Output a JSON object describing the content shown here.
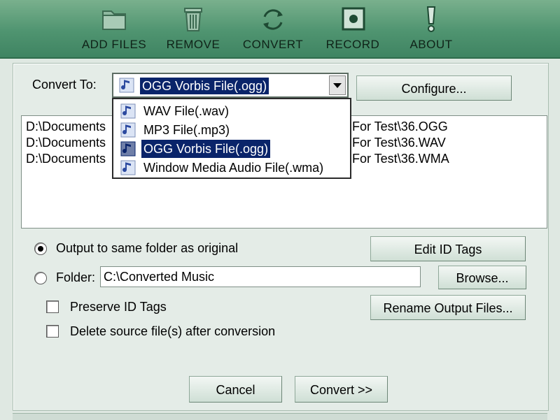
{
  "toolbar": {
    "add_files": "ADD FILES",
    "remove": "REMOVE",
    "convert": "CONVERT",
    "record": "RECORD",
    "about": "ABOUT"
  },
  "convert_to": {
    "label": "Convert To:",
    "selected": "OGG Vorbis File(.ogg)",
    "options": [
      "WAV File(.wav)",
      "MP3 File(.mp3)",
      "OGG Vorbis File(.ogg)",
      "Window Media Audio File(.wma)"
    ],
    "selected_index": 2
  },
  "configure_label": "Configure...",
  "files": [
    {
      "left": "D:\\Documents",
      "right": "For Test\\36.OGG"
    },
    {
      "left": "D:\\Documents",
      "right": "For Test\\36.WAV"
    },
    {
      "left": "D:\\Documents",
      "right": "For Test\\36.WMA"
    }
  ],
  "output": {
    "same_folder_label": "Output to same folder as original",
    "same_folder_selected": true,
    "folder_label": "Folder:",
    "folder_value": "C:\\Converted Music",
    "folder_selected": false
  },
  "buttons": {
    "edit_id_tags": "Edit ID Tags",
    "browse": "Browse...",
    "rename_output": "Rename Output Files...",
    "cancel": "Cancel",
    "convert": "Convert >>"
  },
  "options": {
    "preserve_id_tags": "Preserve ID Tags",
    "preserve_checked": false,
    "delete_source": "Delete source file(s) after conversion",
    "delete_checked": false
  },
  "colors": {
    "toolbar_green": "#4f9470",
    "panel_bg": "#e4ece7",
    "selection_blue": "#0a246a"
  },
  "icons": [
    "folder-icon",
    "trash-icon",
    "convert-arrows-icon",
    "record-icon",
    "exclamation-icon",
    "music-note-icon"
  ]
}
